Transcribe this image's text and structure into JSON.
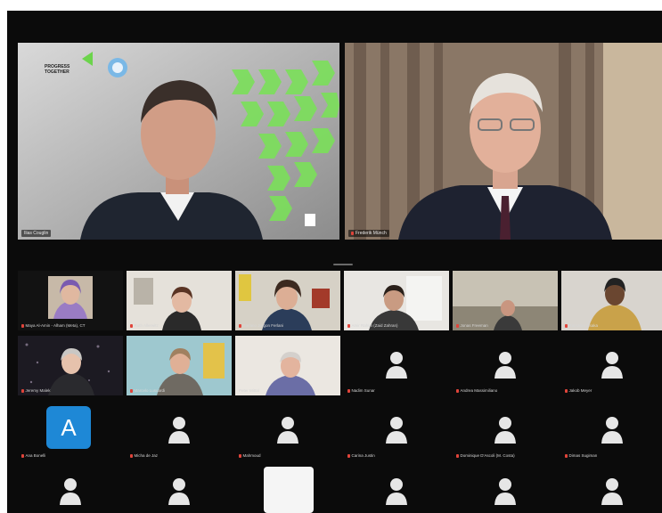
{
  "meeting": {
    "speakers": [
      {
        "name": "Ilias Couglin",
        "logo_text": "PROGRESS TOGETHER"
      },
      {
        "name": "Frederik Münch"
      }
    ],
    "participants": [
      {
        "name": "Maya Al-Amin - Alham (Meta), CT",
        "has_video": true
      },
      {
        "name": "Ruth Allerwitz",
        "has_video": true
      },
      {
        "name": "Stefano Jorgon Ferlani",
        "has_video": true
      },
      {
        "name": "Amir Rahim (Zaid Zahran)",
        "has_video": true
      },
      {
        "name": "Jonas Freeman",
        "has_video": true
      },
      {
        "name": "Ramatou Issaka",
        "has_video": true
      },
      {
        "name": "Jeremy Malek",
        "has_video": true
      },
      {
        "name": "Marcelo Lusuardi",
        "has_video": true
      },
      {
        "name": "Peter Mittal",
        "has_video": true
      },
      {
        "name": "Nadim Sunar",
        "has_video": false
      },
      {
        "name": "Andrea Massimiliano",
        "has_video": false
      },
      {
        "name": "Jakob Meyer",
        "has_video": false
      },
      {
        "name": "Ana Bonelli",
        "has_video": false,
        "avatar_letter": "A"
      },
      {
        "name": "Micha de Jaz",
        "has_video": false
      },
      {
        "name": "Mahmoud",
        "has_video": false
      },
      {
        "name": "Carina Justin",
        "has_video": false
      },
      {
        "name": "Dominique D'Ascoli (M. Costa)",
        "has_video": false
      },
      {
        "name": "Dimas Sugiman",
        "has_video": false
      }
    ]
  }
}
